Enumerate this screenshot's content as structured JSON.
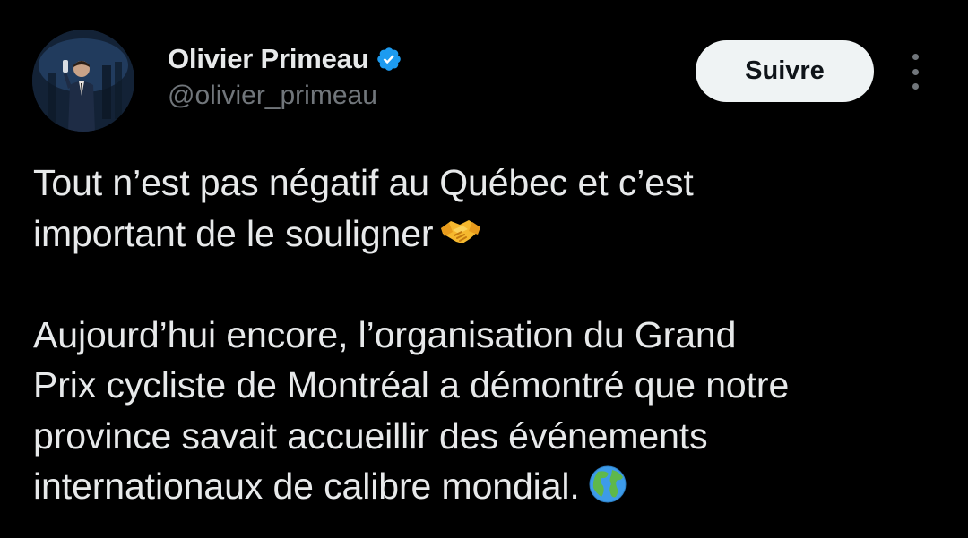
{
  "tweet": {
    "author": {
      "display_name": "Olivier Primeau",
      "handle": "@olivier_primeau",
      "verified": true
    },
    "follow_label": "Suivre",
    "paragraphs": [
      {
        "text": "Tout n’est pas négatif au Québec et c’est\nimportant de le souligner",
        "emoji": "handshake-emoji"
      },
      {
        "text": "Aujourd’hui encore, l’organisation du Grand\nPrix cycliste de Montréal a démontré que notre\nprovince savait accueillir des événements\ninternationaux de calibre mondial.",
        "emoji": "globe-emoji"
      }
    ]
  },
  "colors": {
    "background": "#000000",
    "text_primary": "#e7e9ea",
    "text_secondary": "#71767b",
    "verified_blue": "#1d9bf0",
    "button_bg": "#eff3f4",
    "button_text": "#0f1419"
  },
  "icons": {
    "verified": "verified-badge-icon",
    "more": "more-options-icon"
  }
}
